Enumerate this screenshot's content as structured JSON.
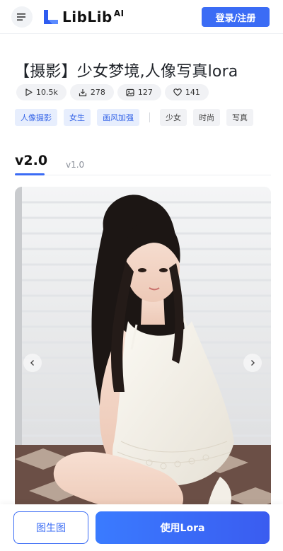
{
  "header": {
    "logo_text": "LibLib",
    "logo_suffix": "AI",
    "login_label": "登录/注册"
  },
  "model": {
    "title": "【摄影】少女梦境,人像写真lora",
    "stats": [
      {
        "icon": "play-icon",
        "value": "10.5k"
      },
      {
        "icon": "download-icon",
        "value": "278"
      },
      {
        "icon": "image-icon",
        "value": "127"
      },
      {
        "icon": "heart-icon",
        "value": "141"
      }
    ],
    "tags_primary": [
      "人像摄影",
      "女生",
      "画风加强"
    ],
    "tags_secondary": [
      "少女",
      "时尚",
      "写真"
    ]
  },
  "versions": {
    "active": "v2.0",
    "inactive": "v1.0"
  },
  "actions": {
    "image_to_image": "图生图",
    "use_lora": "使用Lora"
  },
  "colors": {
    "accent": "#3b6cf5",
    "tag_blue_bg": "#e7eefd",
    "tag_blue_text": "#3766e8"
  }
}
